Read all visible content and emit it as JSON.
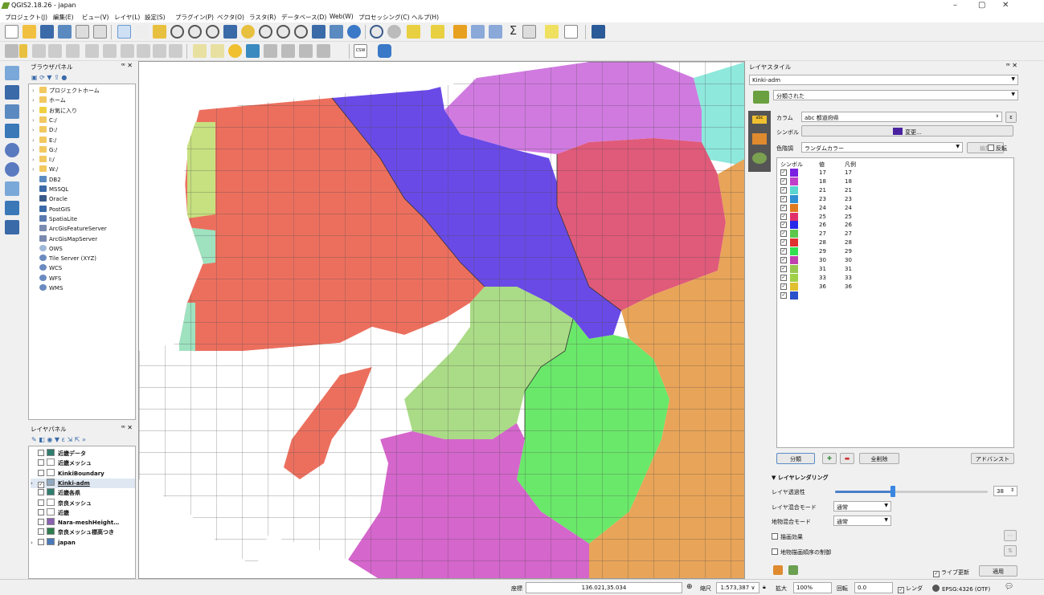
{
  "window": {
    "title": "QGIS2.18.26 - japan"
  },
  "menu": [
    "プロジェクト(J)",
    "編集(E)",
    "ビュー(V)",
    "レイヤ(L)",
    "設定(S)",
    "プラグイン(P)",
    "ベクタ(O)",
    "ラスタ(R)",
    "データベース(D)",
    "Web(W)",
    "プロセッシング(C)",
    "ヘルプ(H)"
  ],
  "browser_panel": {
    "title": "ブラウザパネル",
    "items": [
      {
        "label": "プロジェクトホーム",
        "icon": "folder-icon",
        "expandable": true
      },
      {
        "label": "ホーム",
        "icon": "folder-icon",
        "expandable": true
      },
      {
        "label": "お気に入り",
        "icon": "star-icon",
        "expandable": true
      },
      {
        "label": "C:/",
        "icon": "folder-icon",
        "expandable": true
      },
      {
        "label": "D:/",
        "icon": "folder-icon",
        "expandable": true
      },
      {
        "label": "E:/",
        "icon": "folder-icon",
        "expandable": true
      },
      {
        "label": "G:/",
        "icon": "folder-icon",
        "expandable": true
      },
      {
        "label": "I:/",
        "icon": "folder-icon",
        "expandable": true
      },
      {
        "label": "W:/",
        "icon": "folder-icon",
        "expandable": true
      },
      {
        "label": "DB2",
        "icon": "db2-icon",
        "expandable": false
      },
      {
        "label": "MSSQL",
        "icon": "mssql-icon",
        "expandable": false
      },
      {
        "label": "Oracle",
        "icon": "oracle-icon",
        "expandable": false
      },
      {
        "label": "PostGIS",
        "icon": "postgis-icon",
        "expandable": false
      },
      {
        "label": "SpatiaLite",
        "icon": "spatialite-icon",
        "expandable": false
      },
      {
        "label": "ArcGisFeatureServer",
        "icon": "arcgis-icon",
        "expandable": false
      },
      {
        "label": "ArcGisMapServer",
        "icon": "arcgis-icon",
        "expandable": false
      },
      {
        "label": "OWS",
        "icon": "ows-icon",
        "expandable": false
      },
      {
        "label": "Tile Server (XYZ)",
        "icon": "globe-icon",
        "expandable": false
      },
      {
        "label": "WCS",
        "icon": "globe-icon",
        "expandable": false
      },
      {
        "label": "WFS",
        "icon": "globe-icon",
        "expandable": false
      },
      {
        "label": "WMS",
        "icon": "globe-icon",
        "expandable": false
      }
    ]
  },
  "layers_panel": {
    "title": "レイヤパネル",
    "items": [
      {
        "label": "近畿データ",
        "checked": false,
        "swatch": "#2e7d6e",
        "expand": false
      },
      {
        "label": "近畿メッシュ",
        "checked": false,
        "swatch": "#ffffff",
        "expand": false
      },
      {
        "label": "KinkiBoundary",
        "checked": false,
        "swatch": "#ffffff",
        "expand": false
      },
      {
        "label": "Kinki-adm",
        "checked": true,
        "swatch": "#8fa8c0",
        "expand": true
      },
      {
        "label": "近畿各県",
        "checked": false,
        "swatch": "#2e7d6e",
        "expand": false
      },
      {
        "label": "奈良メッシュ",
        "checked": false,
        "swatch": "#ffffff",
        "expand": false
      },
      {
        "label": "近畿",
        "checked": false,
        "swatch": "#ffffff",
        "expand": false
      },
      {
        "label": "Nara-meshHeight…",
        "checked": false,
        "swatch": "#8a62b0",
        "expand": false
      },
      {
        "label": "奈良メッシュ標高つき",
        "checked": false,
        "swatch": "#2e7d4e",
        "expand": false
      },
      {
        "label": "japan",
        "checked": false,
        "swatch": "#4a78b8",
        "expand": true
      }
    ]
  },
  "style_panel": {
    "title": "レイヤスタイル",
    "layer": "Kinki-adm",
    "renderer": "分類された",
    "column_label": "カラム",
    "column_value": "abc 都道府県",
    "symbol_label": "シンボル",
    "symbol_change": "変更...",
    "ramp_label": "色階調",
    "ramp_value": "ランダムカラー",
    "edit_button": "編集",
    "invert_label": "反転",
    "table_headers": {
      "symbol": "シンボル",
      "value": "値",
      "legend": "凡例"
    },
    "classes": [
      {
        "value": "17",
        "legend": "17",
        "color": "#7b1fe0"
      },
      {
        "value": "18",
        "legend": "18",
        "color": "#c03ec8"
      },
      {
        "value": "21",
        "legend": "21",
        "color": "#5ad6d0"
      },
      {
        "value": "23",
        "legend": "23",
        "color": "#2f8fd0"
      },
      {
        "value": "24",
        "legend": "24",
        "color": "#e07a1e"
      },
      {
        "value": "25",
        "legend": "25",
        "color": "#e0306a"
      },
      {
        "value": "26",
        "legend": "26",
        "color": "#2a28e8"
      },
      {
        "value": "27",
        "legend": "27",
        "color": "#5cc84a"
      },
      {
        "value": "28",
        "legend": "28",
        "color": "#e03030"
      },
      {
        "value": "29",
        "legend": "29",
        "color": "#30e050"
      },
      {
        "value": "30",
        "legend": "30",
        "color": "#c040b0"
      },
      {
        "value": "31",
        "legend": "31",
        "color": "#98c850"
      },
      {
        "value": "33",
        "legend": "33",
        "color": "#a0d048"
      },
      {
        "value": "36",
        "legend": "36",
        "color": "#e0c030"
      },
      {
        "value": "",
        "legend": "",
        "color": "#2850c8"
      }
    ],
    "classify_button": "分類",
    "delete_all_button": "全削除",
    "advanced_button": "アドバンスト",
    "rendering_header": "レイヤレンダリング",
    "opacity_label": "レイヤ透過性",
    "opacity_value": "38",
    "opacity_fraction": 0.38,
    "blend_label": "レイヤ混合モード",
    "blend_value": "通常",
    "feature_blend_label": "地物混合モード",
    "feature_blend_value": "通常",
    "draw_effects_label": "描画効果",
    "feature_order_label": "地物描画順序の制御",
    "live_update_label": "ライブ更新",
    "apply_button": "適用"
  },
  "status": {
    "coord_label": "座標",
    "coord_value": "136.021,35.034",
    "scale_label": "縮尺",
    "scale_value": "1:573,387",
    "magnify_label": "拡大",
    "magnify_value": "100%",
    "rotation_label": "回転",
    "rotation_value": "0.0",
    "render_label": "レンダ",
    "crs_value": "EPSG:4326 (OTF)"
  },
  "map_colors": {
    "hyogo": "#ec6f5e",
    "kyoto": "#6a4ae6",
    "shiga": "#e05a7a",
    "osaka": "#aadb86",
    "nara": "#6ae86a",
    "wakayama": "#d566cc",
    "mie": "#e8a458",
    "fukui": "#d07ae0",
    "cyan": "#8ee8dc",
    "tottori": "#c7e080",
    "okayama": "#9ee2c0"
  }
}
